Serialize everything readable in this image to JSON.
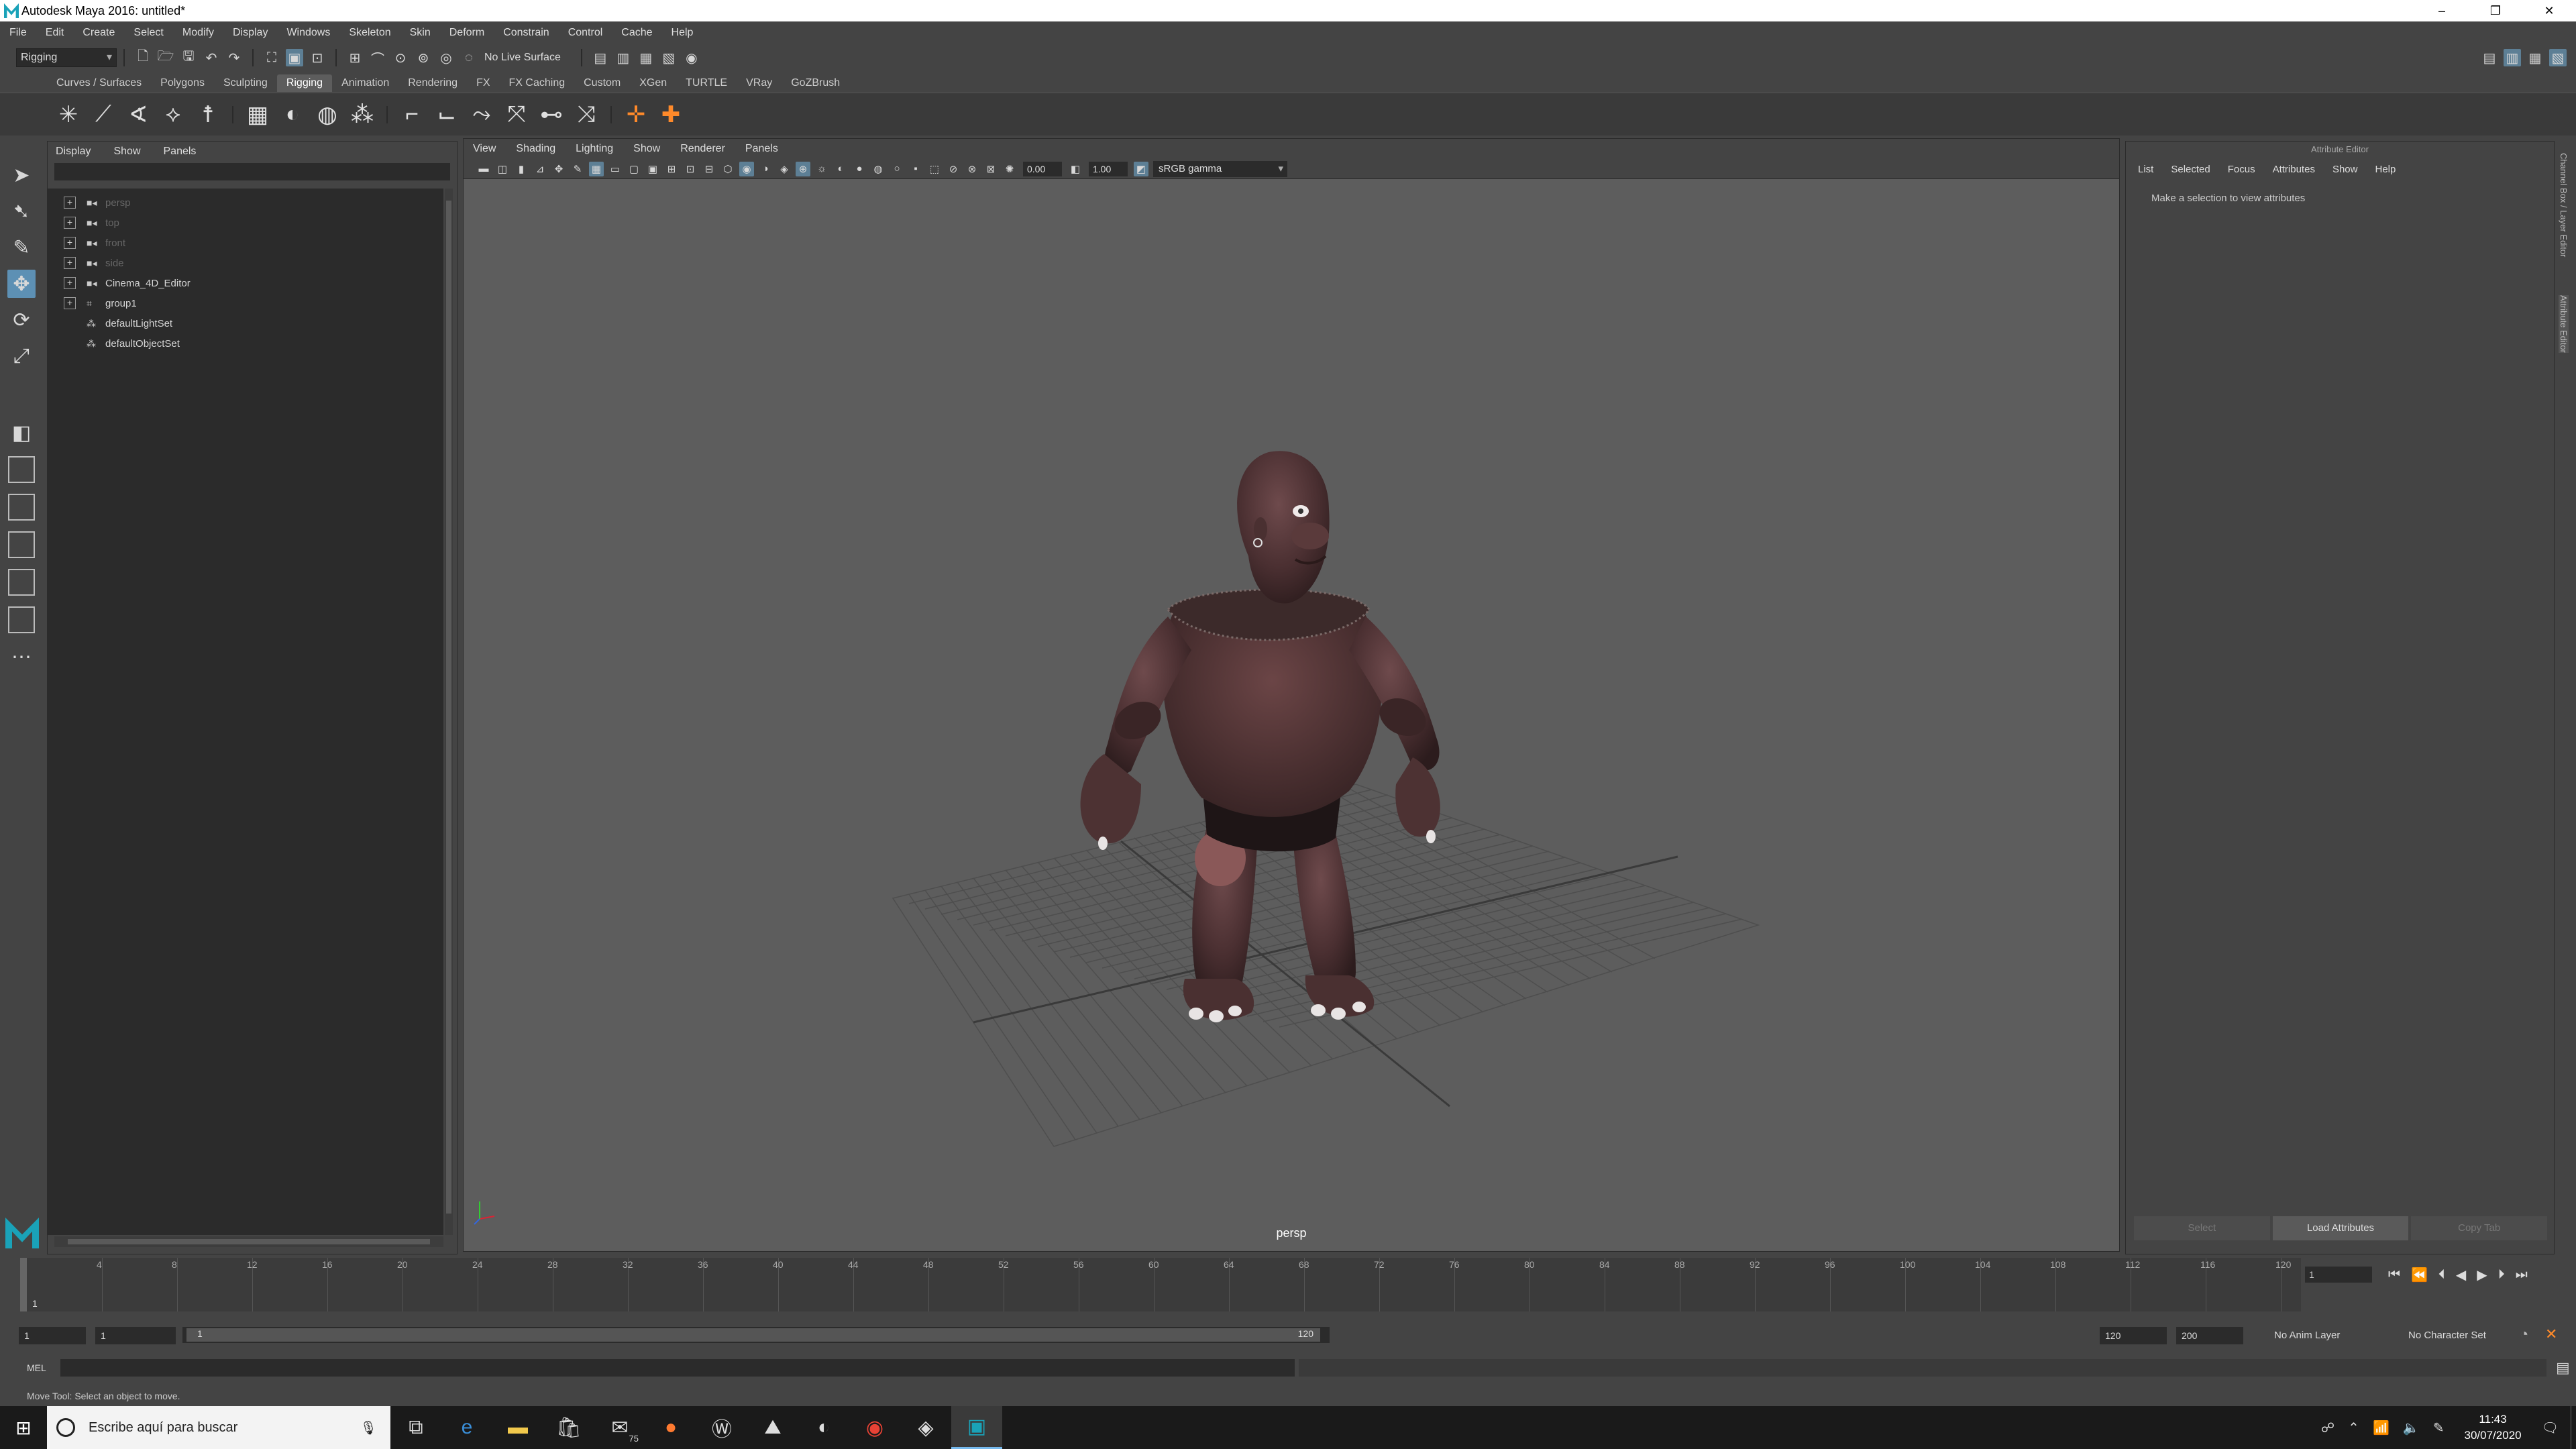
{
  "title": "Autodesk Maya 2016: untitled*",
  "window_buttons": [
    "–",
    "❐",
    "✕"
  ],
  "menu": [
    "File",
    "Edit",
    "Create",
    "Select",
    "Modify",
    "Display",
    "Windows",
    "Skeleton",
    "Skin",
    "Deform",
    "Constrain",
    "Control",
    "Cache",
    "Help"
  ],
  "statusline": {
    "menuset": "Rigging",
    "live_surface": "No Live Surface"
  },
  "shelf_tabs": [
    "Curves / Surfaces",
    "Polygons",
    "Sculpting",
    "Rigging",
    "Animation",
    "Rendering",
    "FX",
    "FX Caching",
    "Custom",
    "XGen",
    "TURTLE",
    "VRay",
    "GoZBrush"
  ],
  "active_shelf_tab": "Rigging",
  "outliner": {
    "menu": [
      "Display",
      "Show",
      "Panels"
    ],
    "items": [
      {
        "label": "persp",
        "type": "camera",
        "hidden": true
      },
      {
        "label": "top",
        "type": "camera",
        "hidden": true
      },
      {
        "label": "front",
        "type": "camera",
        "hidden": true
      },
      {
        "label": "side",
        "type": "camera",
        "hidden": true
      },
      {
        "label": "Cinema_4D_Editor",
        "type": "camera",
        "hidden": false
      },
      {
        "label": "group1",
        "type": "group",
        "hidden": false
      },
      {
        "label": "defaultLightSet",
        "type": "set",
        "hidden": false
      },
      {
        "label": "defaultObjectSet",
        "type": "set",
        "hidden": false
      }
    ]
  },
  "viewport": {
    "menu": [
      "View",
      "Shading",
      "Lighting",
      "Show",
      "Renderer",
      "Panels"
    ],
    "exposure": "0.00",
    "gamma_value": "1.00",
    "color_space": "sRGB gamma",
    "camera": "persp"
  },
  "attribute_editor": {
    "header": "Attribute Editor",
    "menu": [
      "List",
      "Selected",
      "Focus",
      "Attributes",
      "Show",
      "Help"
    ],
    "message": "Make a selection to view attributes",
    "buttons": [
      "Select",
      "Load Attributes",
      "Copy Tab"
    ],
    "side_tabs": [
      "Channel Box / Layer Editor",
      "Attribute Editor"
    ]
  },
  "timeslider": {
    "ticks": [
      "4",
      "8",
      "12",
      "16",
      "20",
      "24",
      "28",
      "32",
      "36",
      "40",
      "44",
      "48",
      "52",
      "56",
      "60",
      "64",
      "68",
      "72",
      "76",
      "80",
      "84",
      "88",
      "92",
      "96",
      "100",
      "104",
      "108",
      "112",
      "116",
      "120"
    ],
    "current": "1",
    "current_field": "1"
  },
  "range": {
    "start": "1",
    "playback_start": "1",
    "range_start_label": "1",
    "range_end_label": "120",
    "playback_end": "120",
    "end": "200",
    "anim_layer": "No Anim Layer",
    "character_set": "No Character Set"
  },
  "cmdline": {
    "label": "MEL"
  },
  "helpline": "Move Tool: Select an object to move.",
  "taskbar": {
    "search_placeholder": "Escribe aquí para buscar",
    "time": "11:43",
    "date": "30/07/2020",
    "mail_badge": "75"
  }
}
